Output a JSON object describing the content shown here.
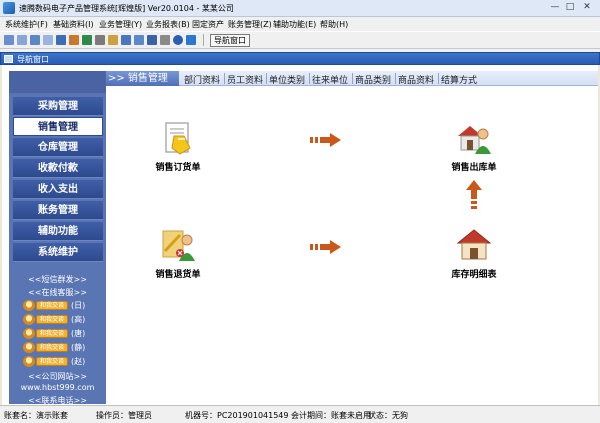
{
  "window": {
    "title": "速腾数码电子产品管理系统[辉煌版] Ver20.0104 - 某某公司"
  },
  "menu": [
    "系统维护(F)",
    "基础资料(I)",
    "业务管理(Y)",
    "业务报表(B)",
    "固定资产",
    "账务管理(Z)",
    "辅助功能(E)",
    "帮助(H)"
  ],
  "toolbar": {
    "nav_button_label": "导航窗口"
  },
  "navwin": {
    "title": "导航窗口"
  },
  "sidebar": {
    "items": [
      "采购管理",
      "销售管理",
      "仓库管理",
      "收款付款",
      "收入支出",
      "账务管理",
      "辅助功能",
      "系统维护"
    ],
    "active_item": "销售管理",
    "sms_link": "<<短信群发>>",
    "service_link": "<<在线客服>>",
    "qq_badge": "和我交谈",
    "contacts": [
      "(日)",
      "(高)",
      "(唐)",
      "(静)",
      "(赵)"
    ],
    "website_link": "<<公司网站>>",
    "website_url": "www.hbst999.com",
    "phone_link": "<<联系电话>>"
  },
  "tabs": {
    "active": ">> 销售管理",
    "items": [
      "部门资料",
      "员工资料",
      "单位类别",
      "往来单位",
      "商品类别",
      "商品资料",
      "结算方式"
    ]
  },
  "flow": {
    "order": "销售订货单",
    "out": "销售出库单",
    "return": "销售退货单",
    "stock": "库存明细表"
  },
  "status": {
    "account": "账套名：演示账套",
    "operator": "操作员：管理员",
    "machine": "机器号：PC201901041549 会计期间：账套未启用",
    "state": "状态：无狗"
  },
  "colors": {
    "sidebar": "#5a75b3",
    "nav_title": "#2a5db4",
    "arrow": "#c8581c"
  }
}
